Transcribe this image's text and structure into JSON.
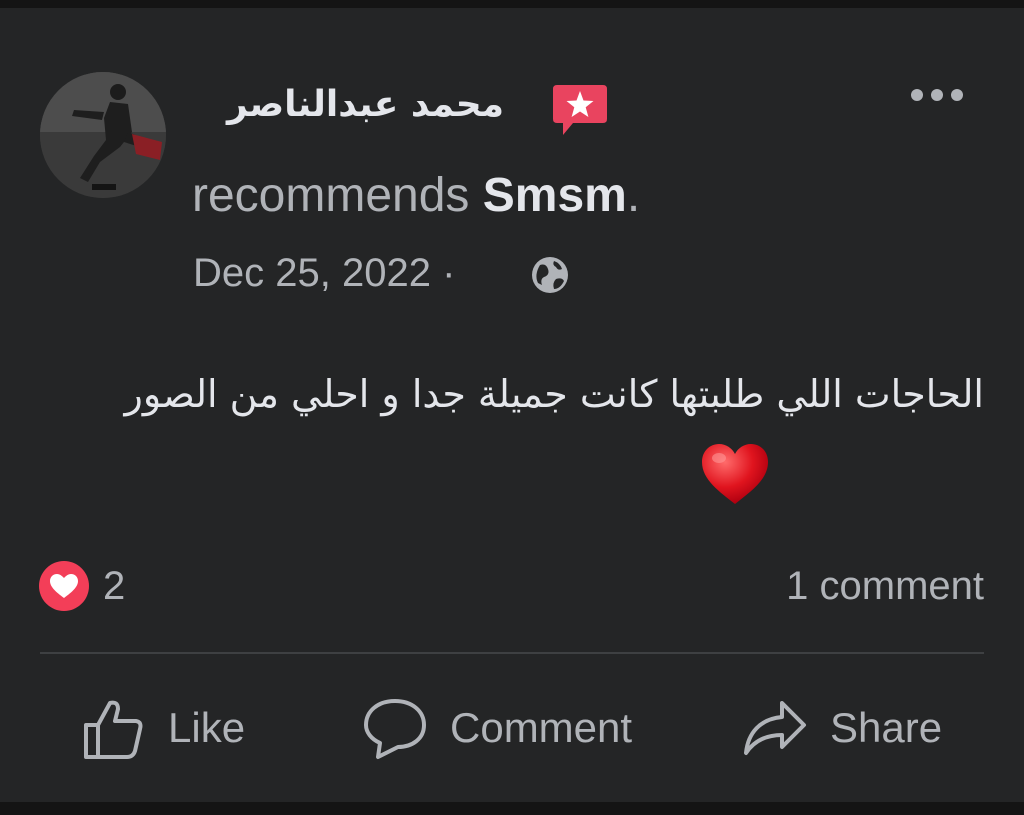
{
  "post": {
    "author_name": "محمد عبدالناصر",
    "recommends_text": "recommends",
    "page_name": "Smsm",
    "period": ".",
    "date": "Dec 25, 2022",
    "separator": " · ",
    "audience_icon": "globe-icon",
    "badge_icon": "recommend-star-icon",
    "more_icon": "more-options-icon",
    "body_text": "الحاجات اللي طلبتها كانت جميلة جدا و احلي من الصور",
    "emoji": "red-heart"
  },
  "stats": {
    "reaction_icon": "love-reaction-icon",
    "reaction_count": "2",
    "comment_count": "1 comment"
  },
  "actions": {
    "like": "Like",
    "comment": "Comment",
    "share": "Share"
  },
  "colors": {
    "background": "#242526",
    "primary_text": "#e4e6eb",
    "secondary_text": "#b0b3b8",
    "badge": "#e9445f",
    "love_reaction": "#f33e58"
  }
}
